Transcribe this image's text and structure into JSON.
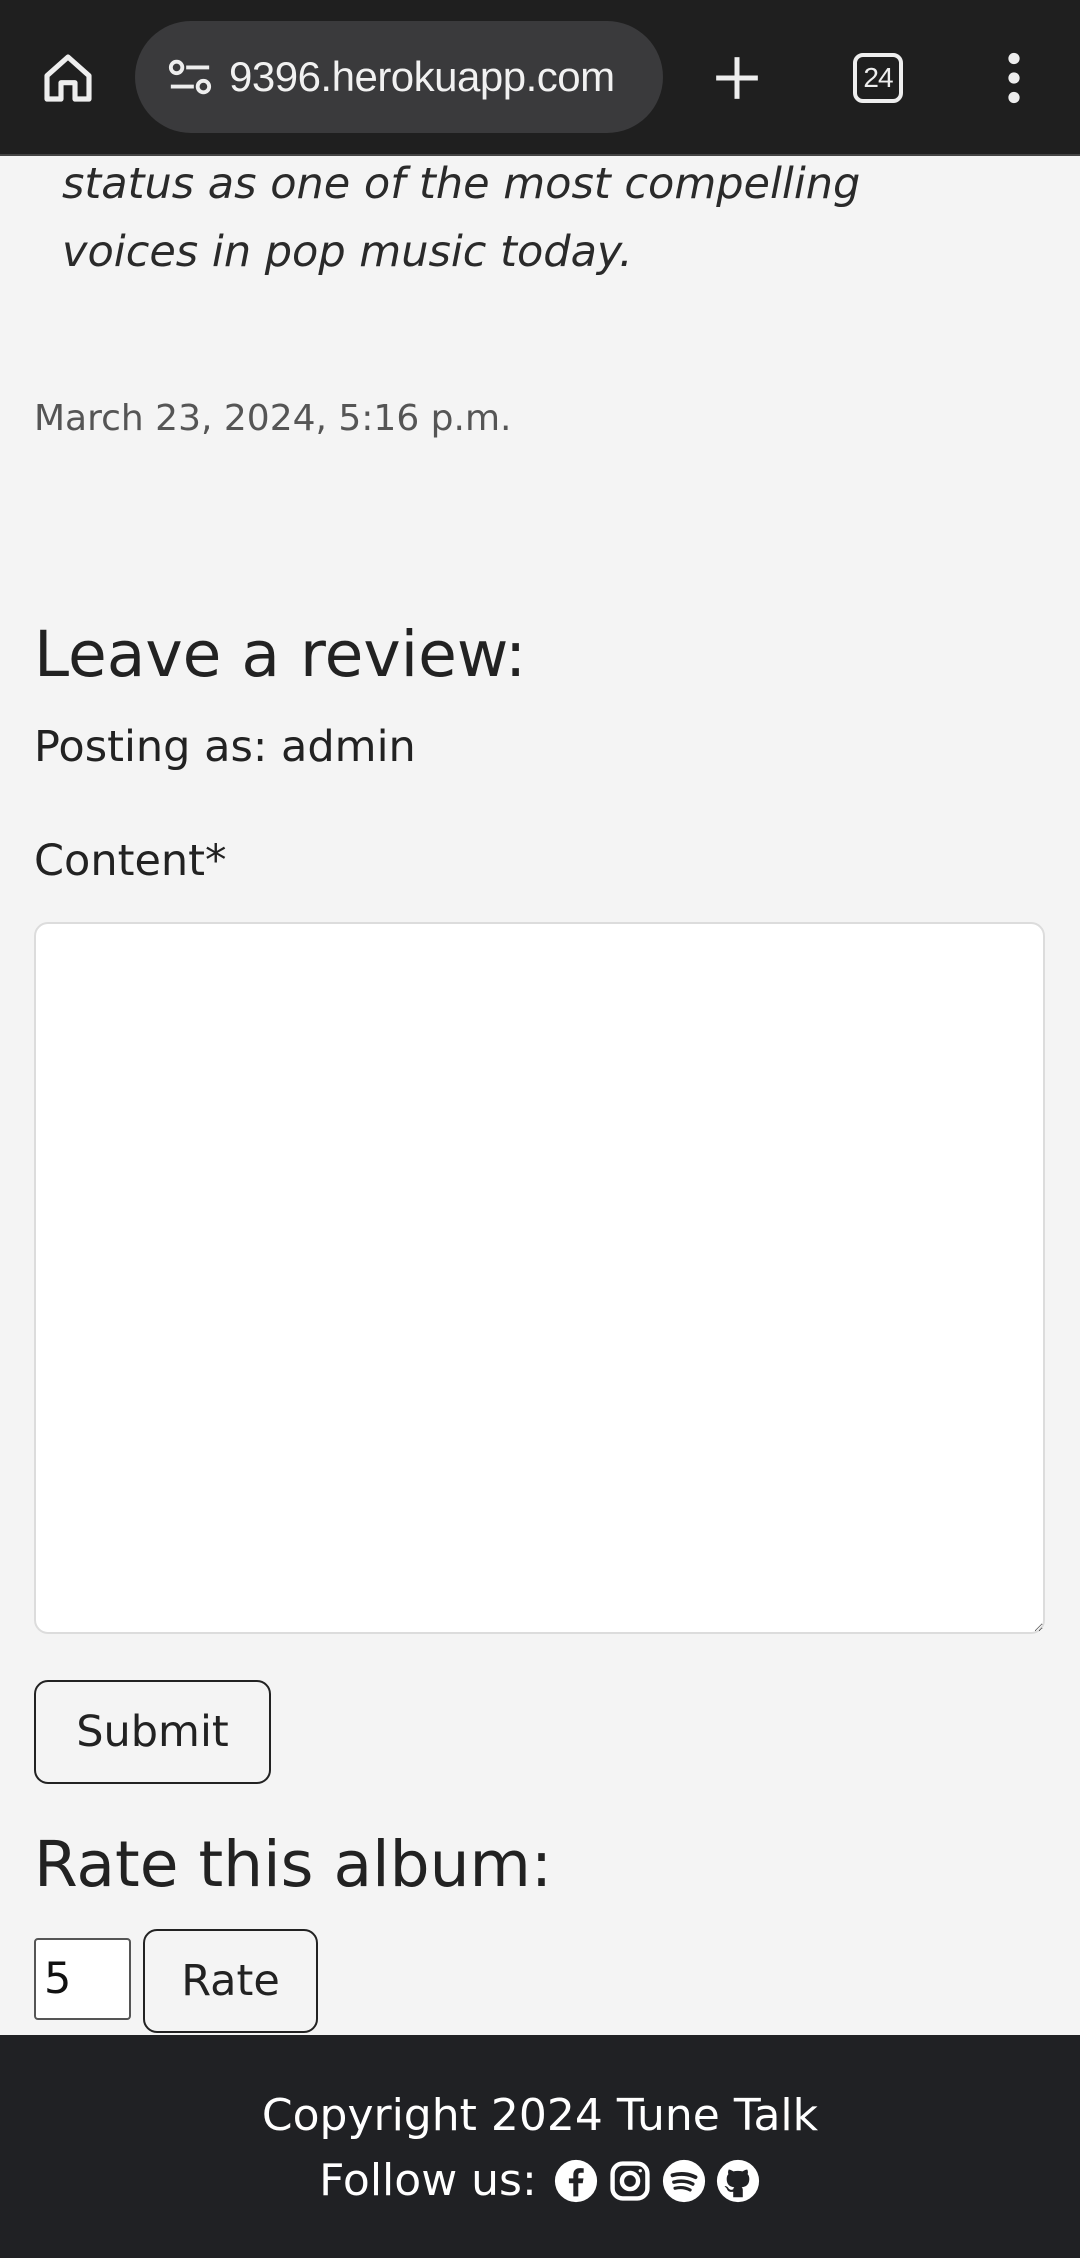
{
  "browser": {
    "url": "9396.herokuapp.com",
    "tab_count": "24"
  },
  "review": {
    "excerpt_line1": "status as one of the most compelling",
    "excerpt_line2": "voices in pop music today.",
    "date": "March 23, 2024, 5:16 p.m."
  },
  "leave_review": {
    "heading": "Leave a review:",
    "posting_as": "Posting as: admin",
    "content_label": "Content*",
    "content_value": "",
    "submit_label": "Submit"
  },
  "rate": {
    "heading": "Rate this album:",
    "rating_value": "5",
    "rate_label": "Rate"
  },
  "footer": {
    "copyright": "Copyright 2024 Tune Talk",
    "follow_label": "Follow us:",
    "social_icons": [
      "facebook-icon",
      "instagram-icon",
      "spotify-icon",
      "github-icon"
    ]
  },
  "colors": {
    "page_bg": "#f4f4f4",
    "browser_bar": "#1f1f1f",
    "footer_bg": "#202124"
  }
}
